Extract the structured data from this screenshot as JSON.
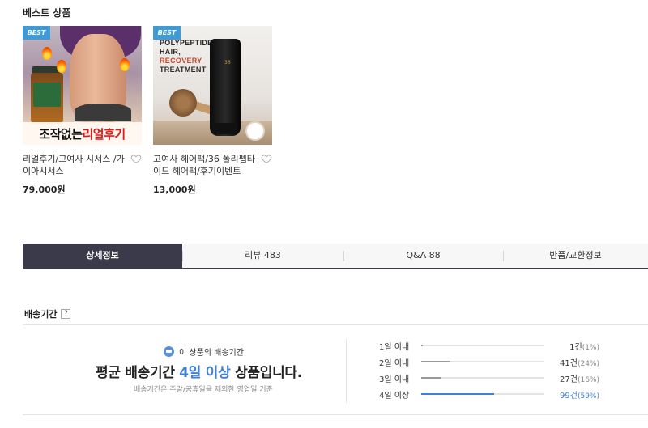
{
  "best_section": {
    "title": "베스트 상품",
    "products": [
      {
        "badge": "BEST",
        "image_banner_black": "조작없는 ",
        "image_banner_red": "리얼후기",
        "name": "리얼후기/고여사 시서스 /가이아시서스",
        "price": "79,000원"
      },
      {
        "badge": "BEST",
        "image_headline_1": "POLYPEPTIDE",
        "image_headline_2": "HAIR,",
        "image_headline_3": "RECOVERY",
        "image_headline_4": "TREATMENT",
        "image_tube_text": "36",
        "name": "고여사 헤어팩/36 폴리펩타이드 헤어팩/후기이벤트",
        "price": "13,000원"
      }
    ]
  },
  "tabs": [
    {
      "label": "상세정보",
      "active": true
    },
    {
      "label": "리뷰 483",
      "active": false
    },
    {
      "label": "Q&A 88",
      "active": false
    },
    {
      "label": "반품/교환정보",
      "active": false
    }
  ],
  "shipping": {
    "title": "배송기간",
    "help": "?",
    "badge_text": "이 상품의 배송기간",
    "main_prefix": "평균 배송기간 ",
    "main_highlight": "4일 이상",
    "main_suffix": " 상품입니다.",
    "note": "배송기간은 주말/공휴일을 제외한 영업일 기준",
    "distribution": [
      {
        "label": "1일 이내",
        "count": "1건",
        "pct": "(1%)",
        "fraction": 0.01
      },
      {
        "label": "2일 이내",
        "count": "41건",
        "pct": "(24%)",
        "fraction": 0.24
      },
      {
        "label": "3일 이내",
        "count": "27건",
        "pct": "(16%)",
        "fraction": 0.16
      },
      {
        "label": "4일 이상",
        "count": "99건",
        "pct": "(59%)",
        "fraction": 0.59,
        "highlight": true
      }
    ]
  },
  "colors": {
    "accent": "#3f7fd8",
    "badge": "#3e9bd5",
    "active_tab": "#3a3a4a"
  }
}
